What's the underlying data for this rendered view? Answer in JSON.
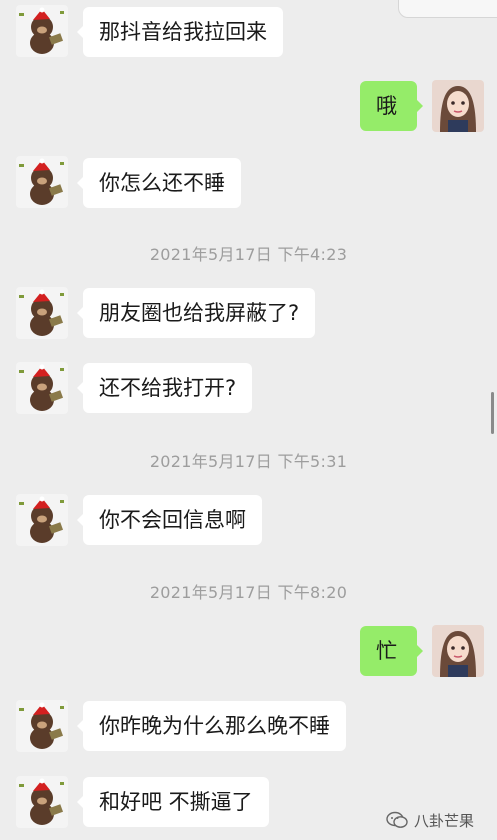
{
  "messages": [
    {
      "type": "in",
      "text": "那抖音给我拉回来"
    },
    {
      "type": "out",
      "text": "哦"
    },
    {
      "type": "in",
      "text": "你怎么还不睡"
    },
    {
      "type": "time",
      "text": "2021年5月17日 下午4:23"
    },
    {
      "type": "in",
      "text": "朋友圈也给我屏蔽了?"
    },
    {
      "type": "in",
      "text": "还不给我打开?"
    },
    {
      "type": "time",
      "text": "2021年5月17日 下午5:31"
    },
    {
      "type": "in",
      "text": "你不会回信息啊"
    },
    {
      "type": "time",
      "text": "2021年5月17日 下午8:20"
    },
    {
      "type": "out",
      "text": "忙"
    },
    {
      "type": "in",
      "text": "你昨晚为什么那么晚不睡"
    },
    {
      "type": "in",
      "text": "和好吧 不撕逼了"
    }
  ],
  "watermark": {
    "text": "八卦芒果"
  },
  "avatars": {
    "incoming": "bear-avatar",
    "outgoing": "girl-avatar"
  }
}
